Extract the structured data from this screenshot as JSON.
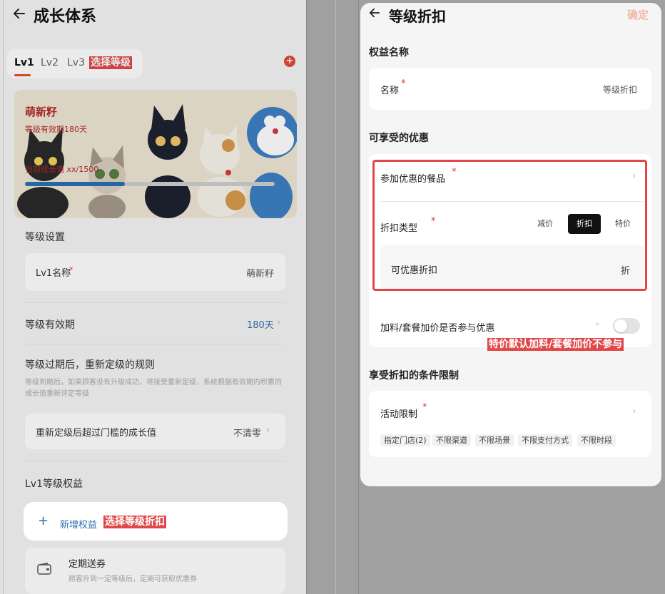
{
  "left": {
    "title": "成长体系",
    "tabs": [
      "Lv1",
      "Lv2",
      "Lv3"
    ],
    "tab_annotation": "选择等级",
    "banner": {
      "title": "萌新籽",
      "subtitle": "等级有效期180天",
      "progress_label": "当前成长值 xx/1500",
      "progress": 0.4
    },
    "level_settings": {
      "section": "等级设置",
      "name_label": "Lv1名称",
      "name_required": "*",
      "name_value": "萌新籽"
    },
    "validity": {
      "label": "等级有效期",
      "value": "180天"
    },
    "expire_rule": {
      "title": "等级过期后，重新定级的规则",
      "hint": "等级到期后，如果顾客没有升级成功，将接受重新定级，系统根据有效期内积累的成长值重新评定等级",
      "row_label": "重新定级后超过门槛的成长值",
      "row_value": "不清零"
    },
    "benefits": {
      "section": "Lv1等级权益",
      "add_label": "新增权益",
      "add_annotation": "选择等级折扣",
      "item_title": "定期送券",
      "item_desc": "顾客升到一定等级后，定期可获取优惠券"
    }
  },
  "right": {
    "title": "等级折扣",
    "confirm": "确定",
    "benefit_name": {
      "section": "权益名称",
      "label": "名称",
      "required": "*",
      "value": "等级折扣"
    },
    "offers": {
      "section": "可享受的优惠",
      "products_label": "参加优惠的餐品",
      "required": "*",
      "discount_type_label": "折扣类型",
      "discount_types": [
        "减价",
        "折扣",
        "特价"
      ],
      "active_type": "折扣",
      "discount_label": "可优惠折扣",
      "discount_unit": "折",
      "addon_label": "加料/套餐加价是否参与优惠",
      "addon_mark": "-",
      "addon_enabled": false,
      "annotation": "特价默认加料/套餐加价不参与"
    },
    "conditions": {
      "section": "享受折扣的条件限制",
      "label": "活动限制",
      "required": "*",
      "chips": [
        "指定门店(2)",
        "不限渠道",
        "不限场景",
        "不限支付方式",
        "不限时段"
      ]
    }
  },
  "colors": {
    "annotation_red": "#e04848",
    "accent_blue": "#2a6fb0",
    "required_red": "#e03a2e"
  }
}
